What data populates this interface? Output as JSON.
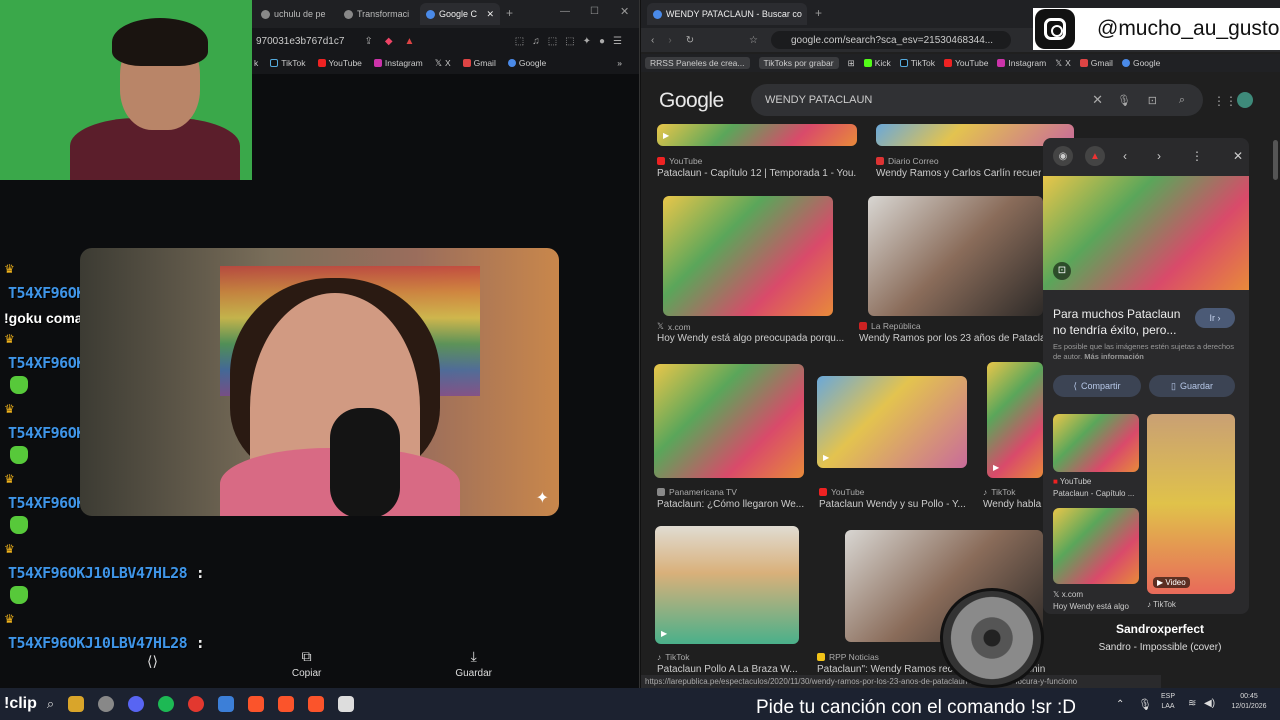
{
  "left_browser": {
    "tabs": [
      {
        "label": "uchulu de pe"
      },
      {
        "label": "Transformaci"
      },
      {
        "label": "Google C"
      }
    ],
    "address_fragment": "970031e3b767d1c7",
    "bookmarks": [
      "k",
      "TikTok",
      "YouTube",
      "Instagram",
      "X",
      "Gmail",
      "Google"
    ]
  },
  "chat": {
    "username": "T54XF96OKJ10LBV47HL28",
    "separator": ":",
    "message": "!goku coma, verga!"
  },
  "image_actions": {
    "share": "",
    "copy": "Copiar",
    "save": "Guardar"
  },
  "right_browser": {
    "tab_title": "WENDY PATACLAUN - Buscar co",
    "url": "google.com/search?sca_esv=21530468344...",
    "bookmarks": {
      "chips": [
        "RRSS Paneles de crea...",
        "TikToks por grabar"
      ],
      "items": [
        "Kick",
        "TikTok",
        "YouTube",
        "Instagram",
        "X",
        "Gmail",
        "Google"
      ]
    },
    "logo": "Google",
    "query": "WENDY PATACLAUN",
    "results": [
      {
        "source": "YouTube",
        "caption": "Pataclaun - Capítulo 12 | Temporada 1 - You..."
      },
      {
        "source": "Diario Correo",
        "caption": "Wendy Ramos y Carlos Carlín recuerd"
      },
      {
        "source": "x.com",
        "caption": "Hoy Wendy está algo preocupada porqu..."
      },
      {
        "source": "La República",
        "caption": "Wendy Ramos por los 23 años de Pataclau"
      },
      {
        "source": "Panamericana TV",
        "caption": "Pataclaun: ¿Cómo llegaron We..."
      },
      {
        "source": "YouTube",
        "caption": "Pataclaun Wendy y su Pollo - Y..."
      },
      {
        "source": "TikTok",
        "caption": "Wendy habla"
      },
      {
        "source": "TikTok",
        "caption": "Pataclaun Pollo A La Braza W..."
      },
      {
        "source": "RPP Noticias",
        "caption": "Pataclaun\": Wendy Ramos recue"
      },
      {
        "source": "",
        "caption": "chin"
      }
    ],
    "panel": {
      "title": "Para muchos Pataclaun no tendría éxito, pero...",
      "go": "Ir",
      "note": "Es posible que las imágenes estén sujetas a derechos de autor.",
      "more_info": "Más información",
      "share": "Compartir",
      "save": "Guardar",
      "related": [
        {
          "source": "YouTube",
          "caption": "Pataclaun - Capítulo ..."
        },
        {
          "source": "x.com",
          "caption": "Hoy Wendy está algo"
        },
        {
          "badge": "Video",
          "source": "TikTok"
        }
      ]
    },
    "status_url": "https://larepublica.pe/espectaculos/2020/11/30/wendy-ramos-por-los-23-anos-de-pataclaun-... ...era-una-locura-y-funciono"
  },
  "instagram": {
    "handle": "@mucho_au_gusto"
  },
  "now_playing": {
    "artist": "Sandroxperfect",
    "title": "Sandro - Impossible (cover)"
  },
  "taskbar": {
    "clip": "!clip",
    "ticker": "Pide tu canción con el comando !sr :D",
    "lang": "ESP",
    "lang2": "LAA",
    "time": "00:45",
    "date": "12/01/2026"
  },
  "colors": {
    "username": "#3f95e8",
    "emote": "#57c93a",
    "crown": "#f2b41c"
  }
}
